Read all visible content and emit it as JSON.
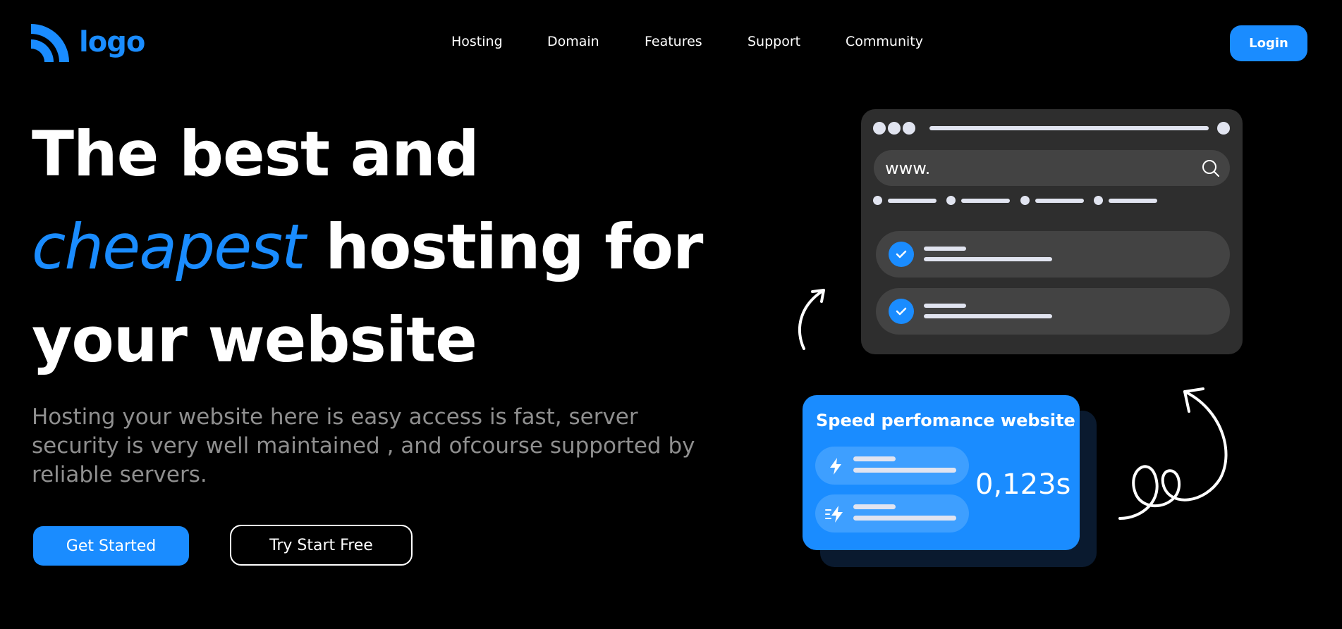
{
  "header": {
    "logo_text": "logo",
    "nav": [
      "Hosting",
      "Domain",
      "Features",
      "Support",
      "Community"
    ],
    "login_label": "Login"
  },
  "hero": {
    "line1": "The best and",
    "line2_accent": "cheapest",
    "line2_rest": " hosting for",
    "line3": "your website",
    "subtitle": "Hosting your website here is easy access is fast, server security is very well maintained , and ofcourse supported by reliable servers.",
    "cta_primary": "Get Started",
    "cta_secondary": "Try Start Free"
  },
  "browser_mockup": {
    "url_text": "www."
  },
  "speed_card": {
    "title": "Speed perfomance website",
    "value": "0,123s"
  },
  "colors": {
    "accent": "#1a8cff",
    "background": "#000000",
    "card": "#2e2e2e",
    "subtitle": "#8f8f8f"
  },
  "icons": [
    "wifi-logo-icon",
    "search-icon",
    "check-icon",
    "lightning-icon",
    "fast-lightning-icon",
    "arrow-icon"
  ]
}
